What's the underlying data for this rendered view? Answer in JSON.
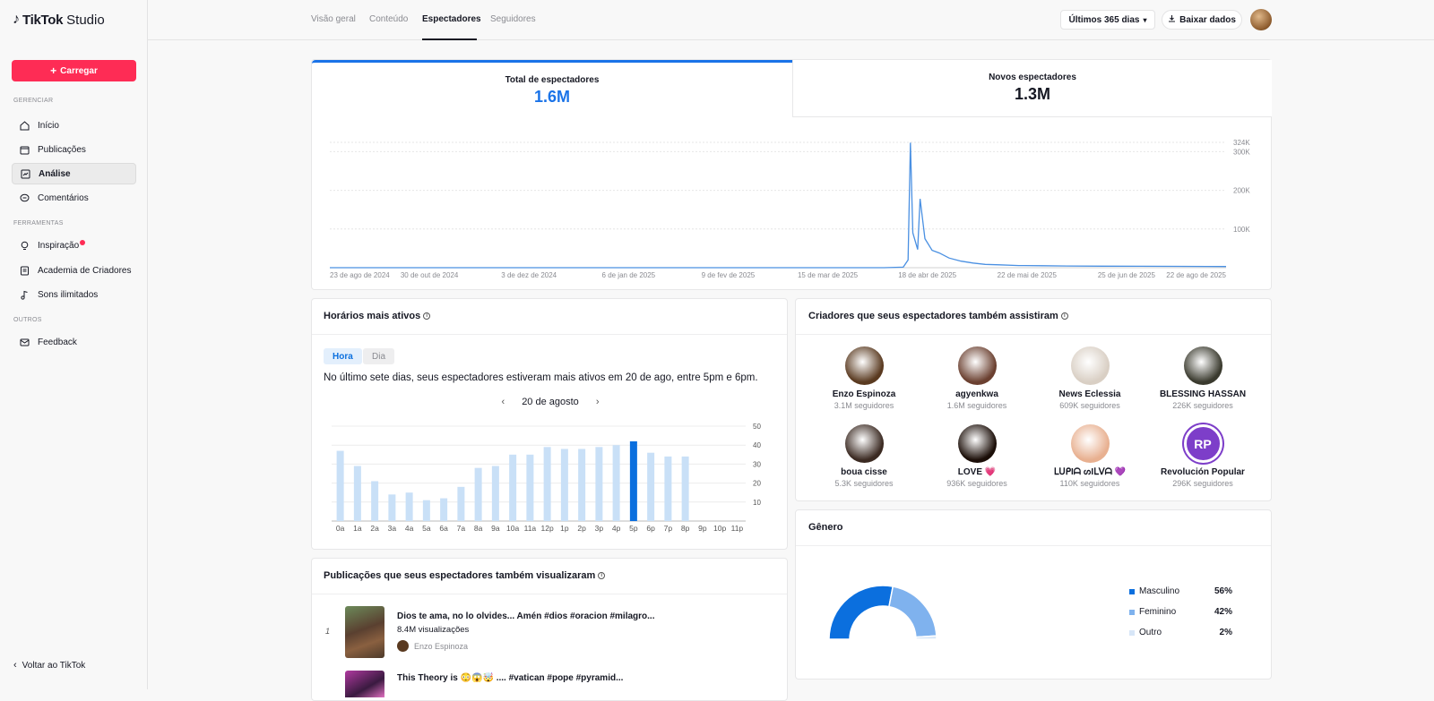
{
  "app": {
    "logo_brand": "TikTok",
    "logo_product": "Studio"
  },
  "sidebar": {
    "upload_label": "Carregar",
    "sections": {
      "manage": "GERENCIAR",
      "tools": "FERRAMENTAS",
      "others": "OUTROS"
    },
    "items": {
      "home": "Início",
      "posts": "Publicações",
      "analytics": "Análise",
      "comments": "Comentários",
      "inspiration": "Inspiração",
      "academy": "Academia de Criadores",
      "sounds": "Sons ilimitados",
      "feedback": "Feedback"
    },
    "back_label": "Voltar ao TikTok"
  },
  "header": {
    "tabs": {
      "overview": "Visão geral",
      "content": "Conteúdo",
      "viewers": "Espectadores",
      "followers": "Seguidores"
    },
    "range_label": "Últimos 365 dias",
    "download_label": "Baixar dados"
  },
  "overview": {
    "total_label": "Total de espectadores",
    "total_value": "1.6M",
    "new_label": "Novos espectadores",
    "new_value": "1.3M",
    "accent": "#1a73e8"
  },
  "chart_data": [
    {
      "type": "line",
      "x_tick_labels": [
        "23 de ago de 2024",
        "30 de out de 2024",
        "3 de dez de 2024",
        "6 de jan de 2025",
        "9 de fev de 2025",
        "15 de mar de 2025",
        "18 de abr de 2025",
        "22 de mai de 2025",
        "25 de jun de 2025",
        "22 de ago de 2025"
      ],
      "y_tick_labels": [
        "324K",
        "300K",
        "200K",
        "100K"
      ],
      "y_ticks": [
        324000,
        300000,
        200000,
        100000
      ],
      "ylim": [
        0,
        324000
      ],
      "x": [
        "2024-08-23",
        "2025-04-10",
        "2025-04-18",
        "2025-04-20",
        "2025-04-21",
        "2025-04-22",
        "2025-04-24",
        "2025-04-25",
        "2025-04-27",
        "2025-04-30",
        "2025-05-03",
        "2025-05-07",
        "2025-05-12",
        "2025-05-17",
        "2025-05-22",
        "2025-05-28",
        "2025-06-05",
        "2025-06-15",
        "2025-06-25",
        "2025-07-10",
        "2025-07-25",
        "2025-08-10",
        "2025-08-22",
        "2025-08-30"
      ],
      "values": [
        0,
        0,
        1500,
        20000,
        323000,
        90000,
        47000,
        178000,
        75000,
        45000,
        38000,
        25000,
        17000,
        12000,
        8500,
        7500,
        5500,
        5000,
        4500,
        4000,
        3800,
        3500,
        3200,
        3000
      ],
      "xlim": [
        "2024-08-23",
        "2025-08-30"
      ],
      "grid": true,
      "color": "#4a90e2"
    },
    {
      "type": "bar",
      "categories": [
        "0a",
        "1a",
        "2a",
        "3a",
        "4a",
        "5a",
        "6a",
        "7a",
        "8a",
        "9a",
        "10a",
        "11a",
        "12p",
        "1p",
        "2p",
        "3p",
        "4p",
        "5p",
        "6p",
        "7p",
        "8p",
        "9p",
        "10p",
        "11p"
      ],
      "values": [
        37,
        29,
        21,
        14,
        15,
        11,
        12,
        18,
        28,
        29,
        35,
        35,
        39,
        38,
        38,
        39,
        40,
        42,
        36,
        34,
        34,
        0,
        0,
        0
      ],
      "highlight_index": 17,
      "ylim": [
        0,
        50
      ],
      "y_ticks": [
        10,
        20,
        30,
        40,
        50
      ],
      "color": "#c9e0f7",
      "highlight_color": "#0b6fde",
      "grid": true
    }
  ],
  "active_hours": {
    "title": "Horários mais ativos",
    "chip_hour": "Hora",
    "chip_day": "Dia",
    "description": "No último sete dias, seus espectadores estiveram mais ativos em 20 de ago, entre 5pm e 6pm.",
    "date_label": "20 de agosto"
  },
  "creators": {
    "title": "Criadores que seus espectadores também assistiram",
    "list": [
      {
        "name": "Enzo Espinoza",
        "followers": "3.1M seguidores",
        "color": "#5a3a20"
      },
      {
        "name": "agyenkwa",
        "followers": "1.6M seguidores",
        "color": "#6b4030"
      },
      {
        "name": "News Eclessia",
        "followers": "609K seguidores",
        "color": "#d9cfc4"
      },
      {
        "name": "BLESSING HASSAN",
        "followers": "226K seguidores",
        "color": "#3a3a2e"
      },
      {
        "name": "boua cisse",
        "followers": "5.3K seguidores",
        "color": "#3b2a22"
      },
      {
        "name": "LOVE 💗",
        "followers": "936K seguidores",
        "color": "#1b0e08"
      },
      {
        "name": "ᒪᑌᑭIᗩ ᔕIᒪᐯᗩ 💜",
        "followers": "110K seguidores",
        "color": "#e8b090"
      },
      {
        "name": "Revolución Popular",
        "followers": "296K seguidores",
        "color": "#7d3ec9",
        "initials": "RP"
      }
    ]
  },
  "gender": {
    "title": "Gênero",
    "items": [
      {
        "label": "Masculino",
        "pct": "56%",
        "value": 56,
        "color": "#0b6fde"
      },
      {
        "label": "Feminino",
        "pct": "42%",
        "value": 42,
        "color": "#7fb2ee"
      },
      {
        "label": "Outro",
        "pct": "2%",
        "value": 2,
        "color": "#d7e6f7"
      }
    ]
  },
  "posts": {
    "title": "Publicações que seus espectadores também visualizaram",
    "items": [
      {
        "rank": "1",
        "caption": "Dios te ama, no lo olvides... Amén #dios #oracion #milagro...",
        "views": "8.4M visualizações",
        "author": "Enzo Espinoza"
      },
      {
        "caption": "This Theory is 😳😱🤯 .... #vatican #pope #pyramid..."
      }
    ]
  }
}
